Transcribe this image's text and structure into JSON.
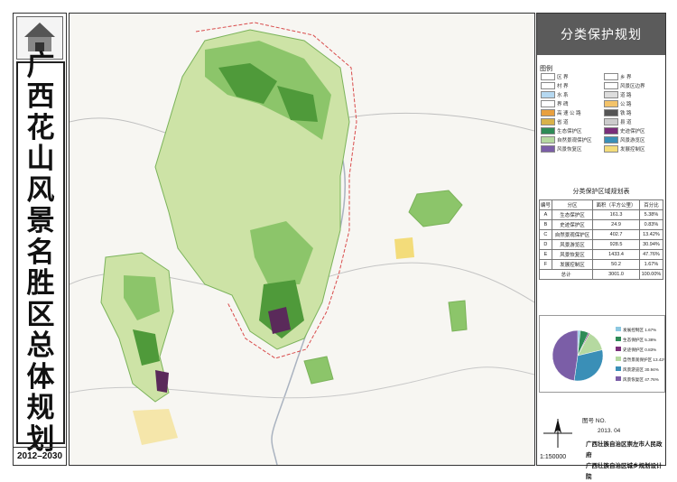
{
  "title_chars": [
    "广",
    "西",
    "花",
    "山",
    "风",
    "景",
    "名",
    "胜",
    "区",
    "总",
    "体",
    "规",
    "划"
  ],
  "years": "2012–2030",
  "panel": {
    "title": "分类保护规划",
    "legend_label": "图例",
    "legend_items": [
      "区 界",
      "乡 界",
      "村 界",
      "风景区边界",
      "水 系",
      "道 路",
      "界 碑",
      "公 路",
      "高 速 公 路",
      "铁 路",
      "省 道",
      "县 道",
      "生态保护区",
      "史迹保护区",
      "自然景观保护区",
      "风景游览区",
      "风景恢复区",
      "发展控制区"
    ]
  },
  "table": {
    "title": "分类保护区域规划表",
    "headers": [
      "编号",
      "分区",
      "面积（平方公里）",
      "百分比"
    ],
    "rows": [
      [
        "A",
        "生态保护区",
        "161.3",
        "5.38%"
      ],
      [
        "B",
        "史迹保护区",
        "24.9",
        "0.83%"
      ],
      [
        "C",
        "自然景观保护区",
        "402.7",
        "13.42%"
      ],
      [
        "D",
        "风景游览区",
        "928.5",
        "30.94%"
      ],
      [
        "E",
        "风景恢复区",
        "1433.4",
        "47.76%"
      ],
      [
        "F",
        "发展控制区",
        "50.2",
        "1.67%"
      ]
    ],
    "total_label": "总计",
    "total_area": "3001.0",
    "total_pct": "100.00%"
  },
  "pie": {
    "labels": [
      "发展控制区 1.67%",
      "生态保护区 5.38%",
      "史迹保护区 0.83%",
      "自然景观保护区 13.42%",
      "风景游览区 30.94%",
      "风景恢复区 47.76%"
    ],
    "values": [
      1.67,
      5.38,
      0.83,
      13.42,
      30.94,
      47.76
    ],
    "colors": [
      "#8cc7e0",
      "#2e8b57",
      "#7a2e7a",
      "#b5d9a0",
      "#3a8fb7",
      "#7b5ea7"
    ]
  },
  "tuhao_label": "图号 NO.",
  "date": "2013. 04",
  "scale": "1:150000",
  "org_lines": [
    "广西壮族自治区崇左市人民政府",
    "广西壮族自治区城乡规划设计院"
  ],
  "colors": {
    "green_dark": "#4f9a3a",
    "green_mid": "#8cc56a",
    "green_light": "#cde3a6",
    "purple": "#5a2a5a",
    "yellow": "#f3dc7a"
  }
}
